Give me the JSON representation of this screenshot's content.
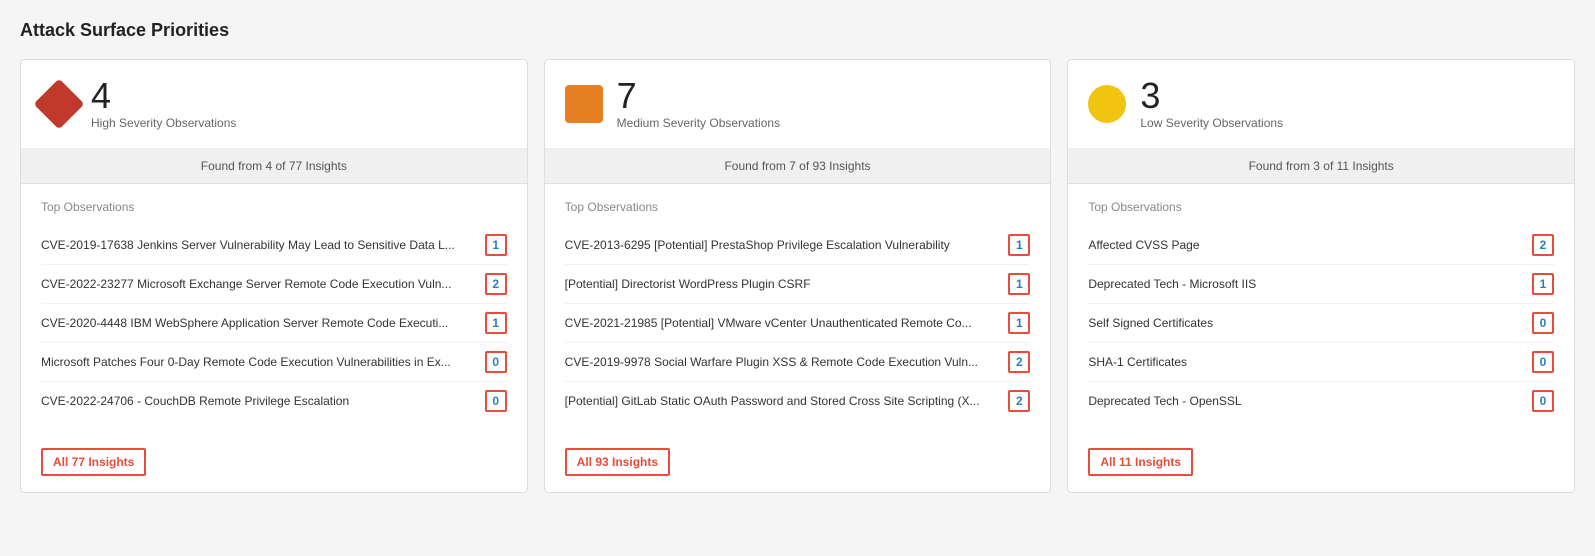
{
  "page": {
    "title": "Attack Surface Priorities"
  },
  "cards": [
    {
      "id": "high",
      "severity_class": "high",
      "count": "4",
      "severity_label": "High Severity Observations",
      "found_bar": "Found from 4 of 77 Insights",
      "top_observations_label": "Top Observations",
      "observations": [
        {
          "text": "CVE-2019-17638 Jenkins Server Vulnerability May Lead to Sensitive Data L...",
          "badge": "1"
        },
        {
          "text": "CVE-2022-23277 Microsoft Exchange Server Remote Code Execution Vuln...",
          "badge": "2"
        },
        {
          "text": "CVE-2020-4448 IBM WebSphere Application Server Remote Code Executi...",
          "badge": "1"
        },
        {
          "text": "Microsoft Patches Four 0-Day Remote Code Execution Vulnerabilities in Ex...",
          "badge": "0"
        },
        {
          "text": "CVE-2022-24706 - CouchDB Remote Privilege Escalation",
          "badge": "0"
        }
      ],
      "insights_link": "All 77 Insights"
    },
    {
      "id": "medium",
      "severity_class": "medium",
      "count": "7",
      "severity_label": "Medium Severity Observations",
      "found_bar": "Found from 7 of 93 Insights",
      "top_observations_label": "Top Observations",
      "observations": [
        {
          "text": "CVE-2013-6295 [Potential] PrestaShop Privilege Escalation Vulnerability",
          "badge": "1"
        },
        {
          "text": "[Potential] Directorist WordPress Plugin CSRF",
          "badge": "1"
        },
        {
          "text": "CVE-2021-21985 [Potential] VMware vCenter Unauthenticated Remote Co...",
          "badge": "1"
        },
        {
          "text": "CVE-2019-9978 Social Warfare Plugin XSS & Remote Code Execution Vuln...",
          "badge": "2"
        },
        {
          "text": "[Potential] GitLab Static OAuth Password and Stored Cross Site Scripting (X...",
          "badge": "2"
        }
      ],
      "insights_link": "All 93 Insights"
    },
    {
      "id": "low",
      "severity_class": "low",
      "count": "3",
      "severity_label": "Low Severity Observations",
      "found_bar": "Found from 3 of 11 Insights",
      "top_observations_label": "Top Observations",
      "observations": [
        {
          "text": "Affected CVSS Page",
          "badge": "2"
        },
        {
          "text": "Deprecated Tech - Microsoft IIS",
          "badge": "1"
        },
        {
          "text": "Self Signed Certificates",
          "badge": "0"
        },
        {
          "text": "SHA-1 Certificates",
          "badge": "0"
        },
        {
          "text": "Deprecated Tech - OpenSSL",
          "badge": "0"
        }
      ],
      "insights_link": "All 11 Insights"
    }
  ]
}
